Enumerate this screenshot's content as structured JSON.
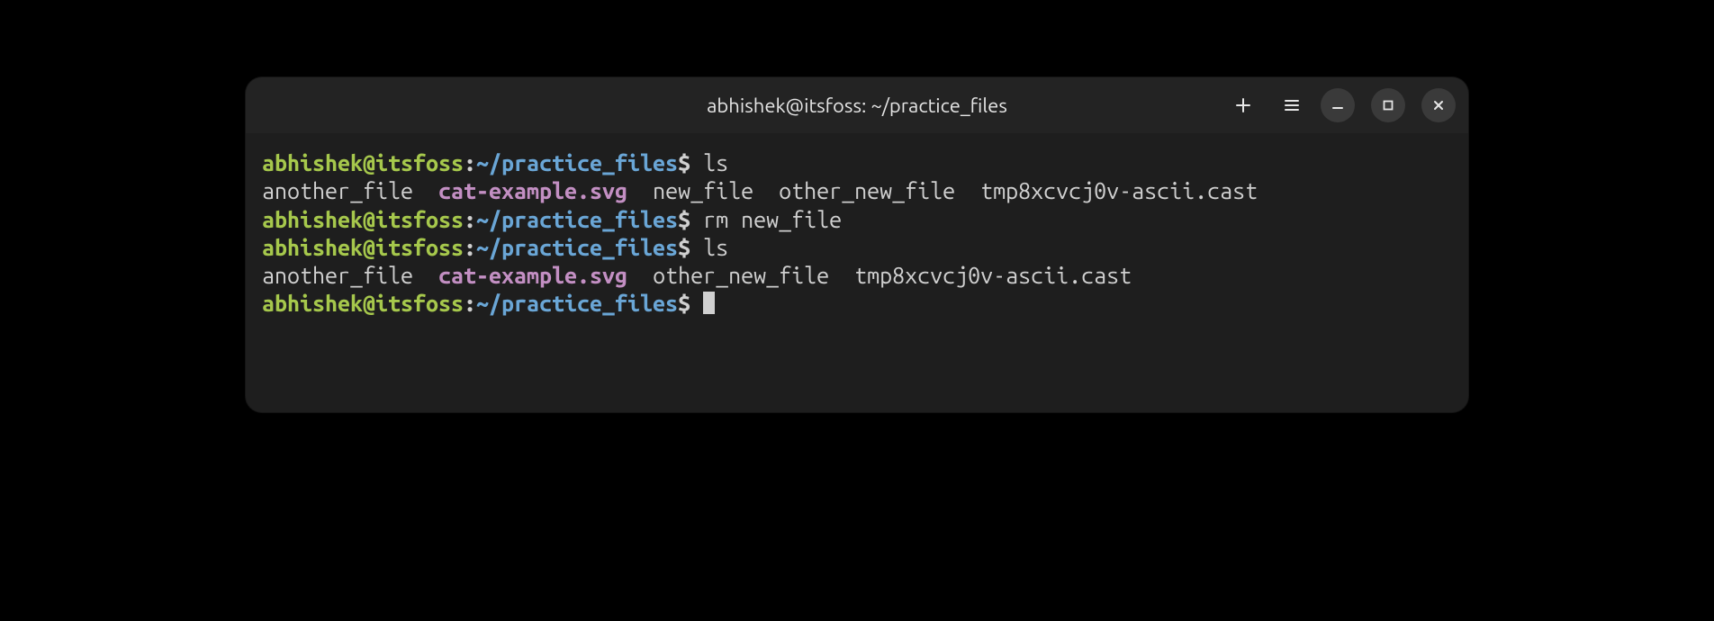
{
  "titlebar": {
    "title": "abhishek@itsfoss: ~/practice_files"
  },
  "prompt": {
    "user_host": "abhishek@itsfoss",
    "path": "~/practice_files",
    "symbol": "$"
  },
  "lines": {
    "cmd1": "ls",
    "ls1_f1": "another_file",
    "ls1_f2": "cat-example.svg",
    "ls1_f3": "new_file",
    "ls1_f4": "other_new_file",
    "ls1_f5": "tmp8xcvcj0v-ascii.cast",
    "cmd2": "rm new_file",
    "cmd3": "ls",
    "ls2_f1": "another_file",
    "ls2_f2": "cat-example.svg",
    "ls2_f3": "other_new_file",
    "ls2_f4": "tmp8xcvcj0v-ascii.cast"
  }
}
